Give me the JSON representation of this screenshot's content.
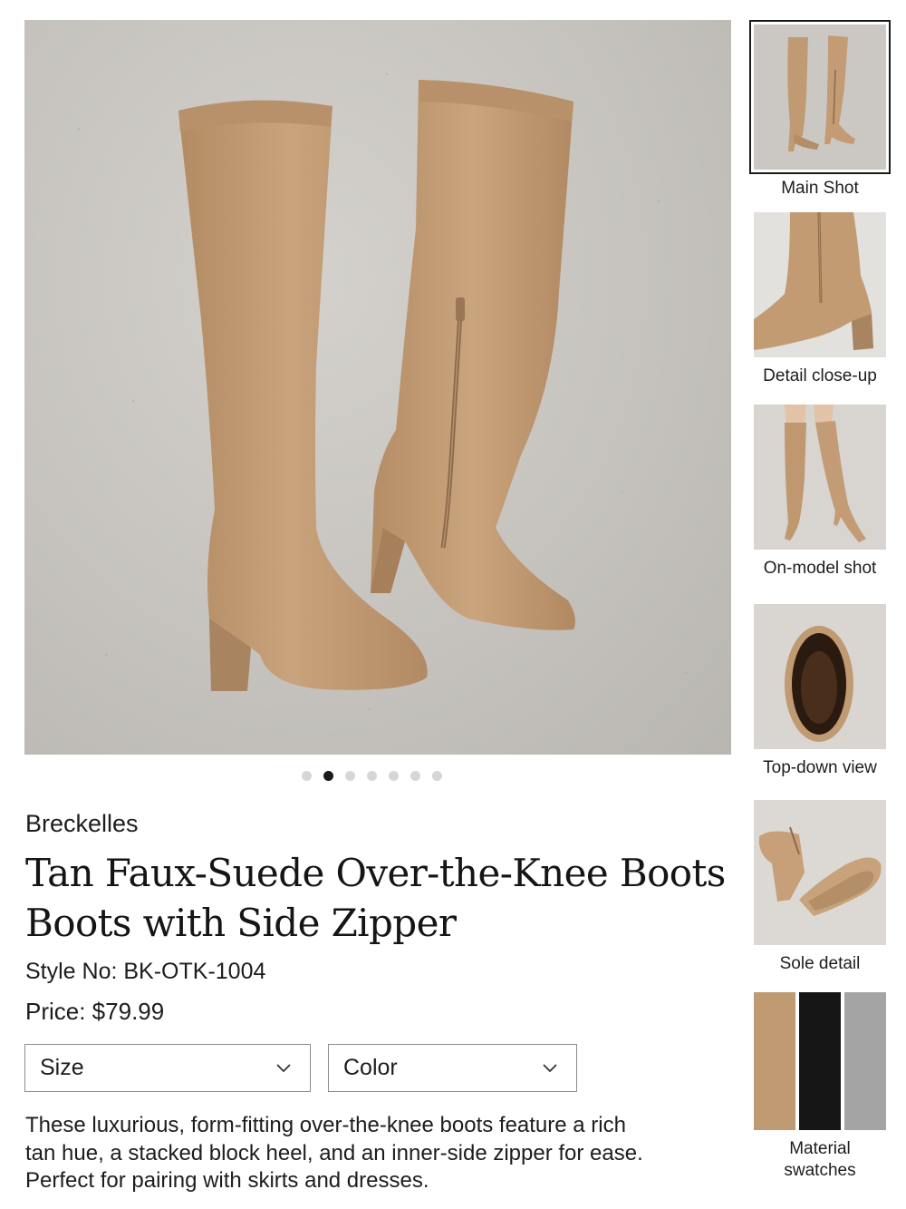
{
  "product": {
    "brand": "Breckelles",
    "title_line1": "Tan Faux-Suede Over-the-Knee Boots",
    "title_line2": "Boots with Side Zipper",
    "style_no": "Style No: BK-OTK-1004",
    "price": "Price: $79.99",
    "description_line1": "These luxurious, form-fitting over-the-knee boots feature a rich",
    "description_line2": "tan hue, a stacked block heel, and an inner-side zipper for ease.",
    "description_line3": "Perfect for pairing with skirts and dresses."
  },
  "selectors": {
    "size_label": "Size",
    "color_label": "Color"
  },
  "gallery": {
    "dot_count": 7,
    "active_dot": 2,
    "thumbnails": [
      {
        "label": "Main Shot"
      },
      {
        "label": "Detail close-up"
      },
      {
        "label": "On-model shot"
      },
      {
        "label": "Top-down view"
      },
      {
        "label": "Sole detail"
      },
      {
        "label_line1": "Material",
        "label_line2": "swatches"
      }
    ],
    "swatch_colors": [
      "#bf9a72",
      "#161616",
      "#a4a4a4"
    ]
  },
  "colors": {
    "suede": "#c49d76",
    "suede_dark": "#9c7a58",
    "concrete": "#c8c5c0",
    "text": "#1a1a1a"
  }
}
